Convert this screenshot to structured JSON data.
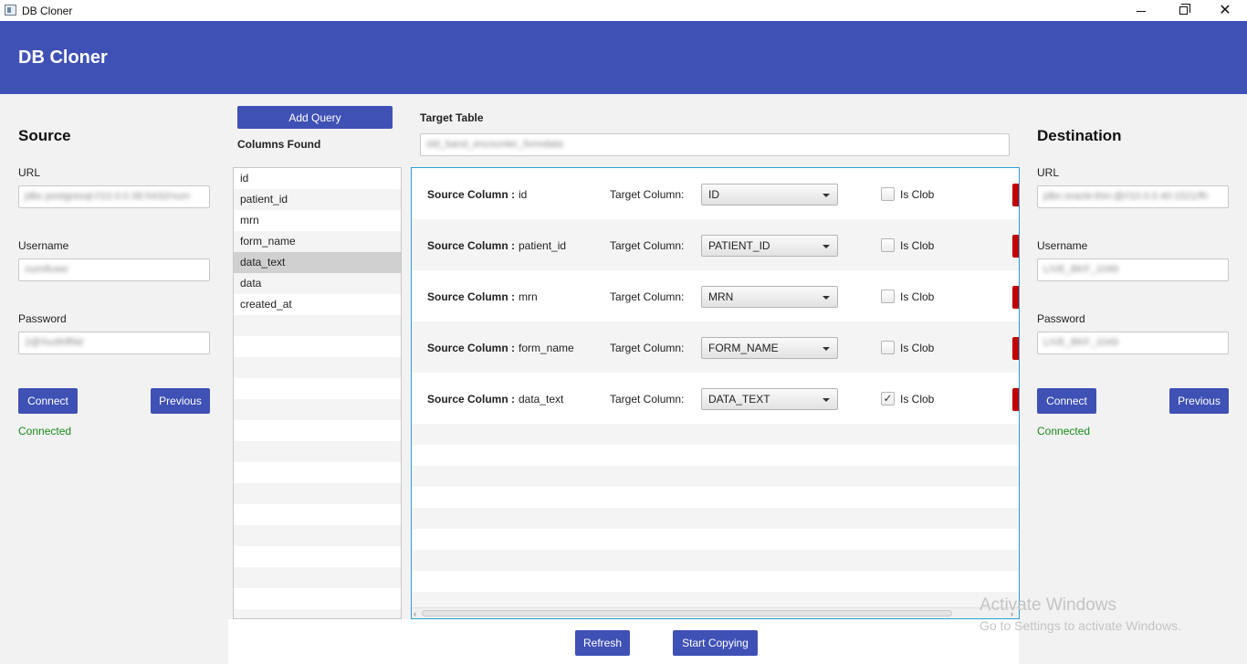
{
  "window": {
    "title": "DB Cloner",
    "icons": [
      "app-icon",
      "minimize-icon",
      "maximize-icon",
      "close-icon"
    ]
  },
  "header": {
    "title": "DB Cloner"
  },
  "colors": {
    "primary": "#3f51b5",
    "connected": "#1a8a1a",
    "focus_border": "#2b9fd6",
    "edge_marker": "#c00000"
  },
  "source": {
    "title": "Source",
    "url_label": "URL",
    "url_value": "jdbc:postgresql://10.0.0.38:5432/num",
    "username_label": "Username",
    "username_value": "numifuser",
    "password_label": "Password",
    "password_value": "2@%u9hff9d",
    "connect_label": "Connect",
    "previous_label": "Previous",
    "status": "Connected"
  },
  "destination": {
    "title": "Destination",
    "url_label": "URL",
    "url_value": "jdbc:oracle:thin:@//10.0.0.40:1521/fh",
    "username_label": "Username",
    "username_value": "LIVE_BKF_1049",
    "password_label": "Password",
    "password_value": "LIVE_BKF_1049",
    "connect_label": "Connect",
    "previous_label": "Previous",
    "status": "Connected"
  },
  "columns": {
    "add_query_label": "Add Query",
    "title": "Columns Found",
    "items": [
      "id",
      "patient_id",
      "mrn",
      "form_name",
      "data_text",
      "data",
      "created_at"
    ],
    "selected": "data_text"
  },
  "target": {
    "label": "Target Table",
    "value": "old_band_encounter_formdata"
  },
  "mapping": {
    "source_label": "Source Column :",
    "target_label": "Target Column:",
    "clob_label": "Is Clob",
    "rows": [
      {
        "source": "id",
        "target": "ID",
        "clob": false
      },
      {
        "source": "patient_id",
        "target": "PATIENT_ID",
        "clob": false
      },
      {
        "source": "mrn",
        "target": "MRN",
        "clob": false
      },
      {
        "source": "form_name",
        "target": "FORM_NAME",
        "clob": false
      },
      {
        "source": "data_text",
        "target": "DATA_TEXT",
        "clob": true
      }
    ]
  },
  "actions": {
    "refresh_label": "Refresh",
    "start_label": "Start Copying"
  },
  "watermark": {
    "line1": "Activate Windows",
    "line2": "Go to Settings to activate Windows."
  }
}
